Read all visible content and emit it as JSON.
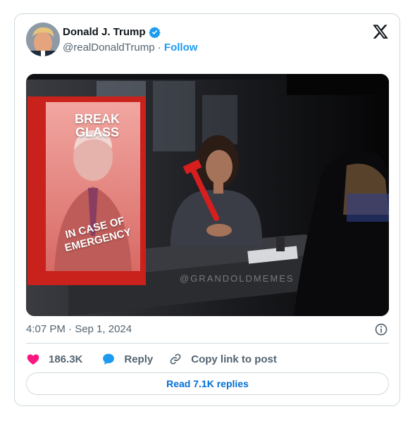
{
  "tweet": {
    "author_name": "Donald J. Trump",
    "handle": "@realDonaldTrump",
    "separator": "·",
    "follow_label": "Follow",
    "timestamp": "4:07 PM · Sep 1, 2024",
    "image_text": {
      "poster_top": "BREAK\nGLASS",
      "poster_bottom": "IN CASE OF\nEMERGENCY",
      "watermark": "@GRANDOLDMEMES"
    }
  },
  "actions": {
    "likes_count": "186.3K",
    "reply_label": "Reply",
    "copy_link_label": "Copy link to post"
  },
  "read_replies_label": "Read 7.1K replies",
  "colors": {
    "like": "#f91880",
    "reply": "#1d9bf0",
    "verified": "#1d9bf0",
    "link": "#006fd6",
    "poster_frame": "#d32a22"
  },
  "icons": [
    "verified-badge-icon",
    "x-logo-icon",
    "info-icon",
    "heart-icon",
    "reply-bubble-icon",
    "link-icon"
  ]
}
